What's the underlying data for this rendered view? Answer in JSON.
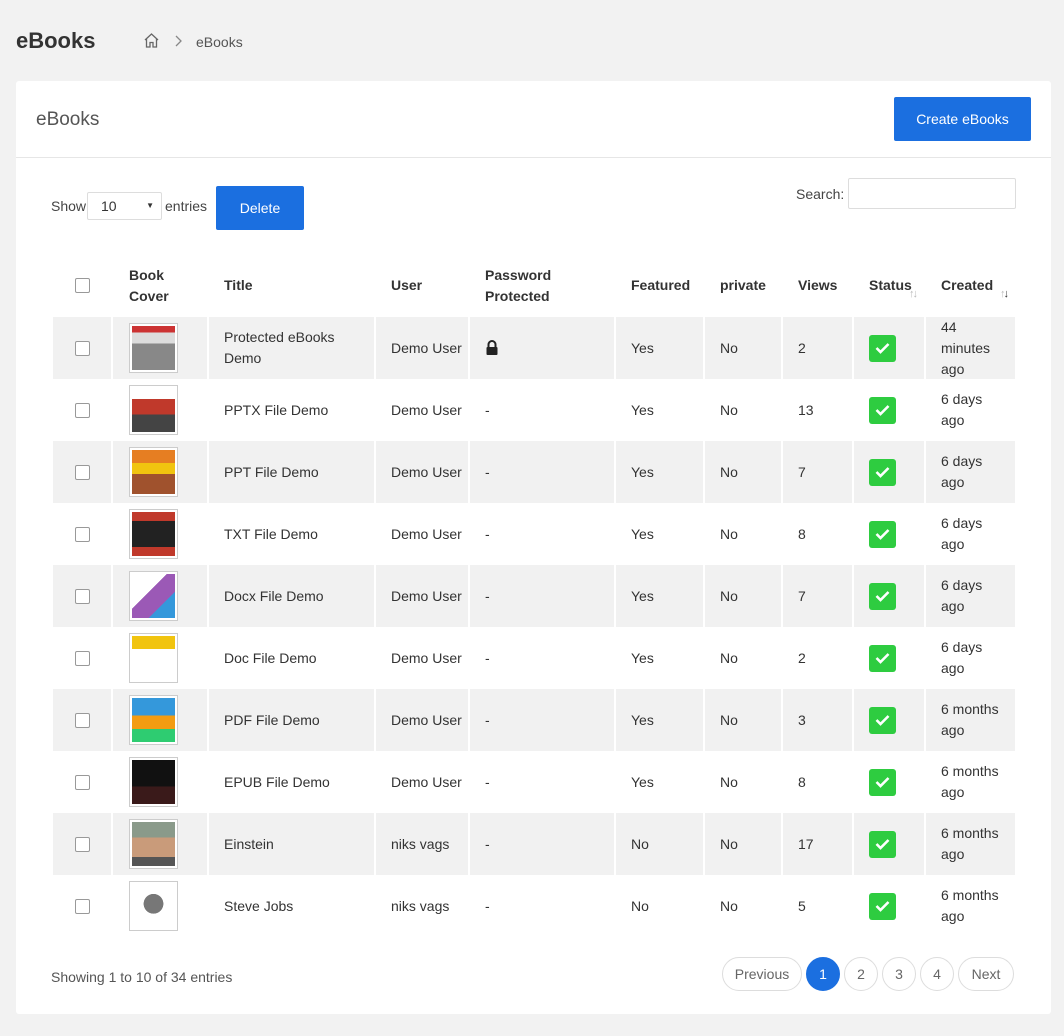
{
  "header": {
    "title": "eBooks",
    "breadcrumb_current": "eBooks"
  },
  "card": {
    "title": "eBooks",
    "create_label": "Create eBooks"
  },
  "controls": {
    "show_label": "Show",
    "page_size": "10",
    "entries_label": "entries",
    "delete_label": "Delete",
    "search_label": "Search:",
    "search_value": ""
  },
  "table": {
    "columns": [
      "",
      "Book Cover",
      "Title",
      "User",
      "Password Protected",
      "Featured",
      "private",
      "Views",
      "Status",
      "Created"
    ],
    "rows": [
      {
        "cover": "book-cover-article-5",
        "title": "Protected eBooks Demo",
        "user": "Demo User",
        "password": "lock-icon",
        "featured": "Yes",
        "private": "No",
        "views": "2",
        "created": "44 minutes ago"
      },
      {
        "cover": "book-cover-php",
        "title": "PPTX File Demo",
        "user": "Demo User",
        "password": "-",
        "featured": "Yes",
        "private": "No",
        "views": "13",
        "created": "6 days ago"
      },
      {
        "cover": "book-cover-indian-diet",
        "title": "PPT File Demo",
        "user": "Demo User",
        "password": "-",
        "featured": "Yes",
        "private": "No",
        "views": "7",
        "created": "6 days ago"
      },
      {
        "cover": "book-cover-batman",
        "title": "TXT File Demo",
        "user": "Demo User",
        "password": "-",
        "featured": "Yes",
        "private": "No",
        "views": "8",
        "created": "6 days ago"
      },
      {
        "cover": "book-cover-programming",
        "title": "Docx File Demo",
        "user": "Demo User",
        "password": "-",
        "featured": "Yes",
        "private": "No",
        "views": "7",
        "created": "6 days ago"
      },
      {
        "cover": "book-cover-abc",
        "title": "Doc File Demo",
        "user": "Demo User",
        "password": "-",
        "featured": "Yes",
        "private": "No",
        "views": "2",
        "created": "6 days ago"
      },
      {
        "cover": "book-cover-kids",
        "title": "PDF File Demo",
        "user": "Demo User",
        "password": "-",
        "featured": "Yes",
        "private": "No",
        "views": "3",
        "created": "6 months ago"
      },
      {
        "cover": "book-cover-dark",
        "title": "EPUB File Demo",
        "user": "Demo User",
        "password": "-",
        "featured": "Yes",
        "private": "No",
        "views": "8",
        "created": "6 months ago"
      },
      {
        "cover": "book-cover-einstein",
        "title": "Einstein",
        "user": "niks vags",
        "password": "-",
        "featured": "No",
        "private": "No",
        "views": "17",
        "created": "6 months ago"
      },
      {
        "cover": "book-cover-steve-jobs",
        "title": "Steve Jobs",
        "user": "niks vags",
        "password": "-",
        "featured": "No",
        "private": "No",
        "views": "5",
        "created": "6 months ago"
      }
    ]
  },
  "footer": {
    "info": "Showing 1 to 10 of 34 entries",
    "previous": "Previous",
    "pages": [
      "1",
      "2",
      "3",
      "4"
    ],
    "current_page": "1",
    "next": "Next"
  },
  "colors": {
    "primary": "#1b6fe0",
    "status_green": "#2ecc40",
    "row_stripe": "#f1f1f1"
  }
}
